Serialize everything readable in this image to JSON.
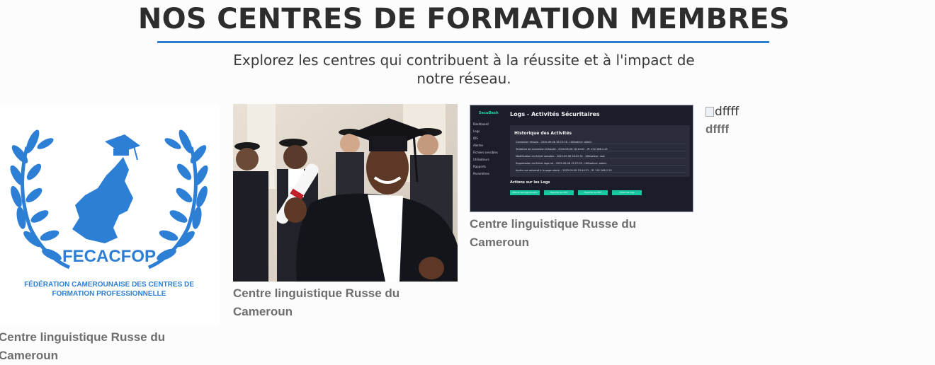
{
  "header": {
    "title": "NOS CENTRES DE FORMATION MEMBRES",
    "subtitle": "Explorez les centres qui contribuent à la réussite et à l'impact de notre réseau."
  },
  "colors": {
    "accent": "#2f7fd0",
    "logo_blue": "#2d7fd6",
    "dash_green": "#18c8a0"
  },
  "cards": [
    {
      "caption": "Centre linguistique Russe du Cameroun",
      "logo_name": "FECACFOP",
      "logo_line1": "FÉDÉRATION CAMEROUNAISE DES CENTRES DE",
      "logo_line2": "FORMATION PROFESSIONNELLE"
    },
    {
      "caption": "Centre linguistique Russe du Cameroun",
      "image_alt": "graduation-photo"
    },
    {
      "caption": "Centre linguistique Russe du Cameroun",
      "dashboard": {
        "brand": "SecuDash",
        "title": "Logs - Activités Sécuritaires",
        "nav": [
          "Dashboard",
          "Logs",
          "IDS",
          "Alertes",
          "Fichiers sensibles",
          "Utilisateurs",
          "Rapports",
          "Paramètres"
        ],
        "panel_title": "Historique des Activités",
        "rows": [
          "Connexion réussie - 2025-09-08 16:13:16 - Utilisateur: admin",
          "Tentative de connexion échouée - 2025-09-08 16:10:02 - IP: 192.168.1.15",
          "Modification du fichier sensible - 2025-09-08 16:02:51 - Utilisateur: root",
          "Suppression du fichier logs.txt - 2025-09-08 15:57:09 - Utilisateur: admin",
          "Accès non autorisé à la page admin - 2025-09-08 15:44:31 - IP: 192.168.1.20"
        ],
        "actions_title": "Actions sur les Logs",
        "buttons": [
          "Effacer les logs anciens",
          "Exporter en CSV",
          "Exporter en PDF",
          "Filtrer les logs"
        ]
      }
    },
    {
      "caption": "dffff",
      "image_alt": "dffff"
    }
  ]
}
